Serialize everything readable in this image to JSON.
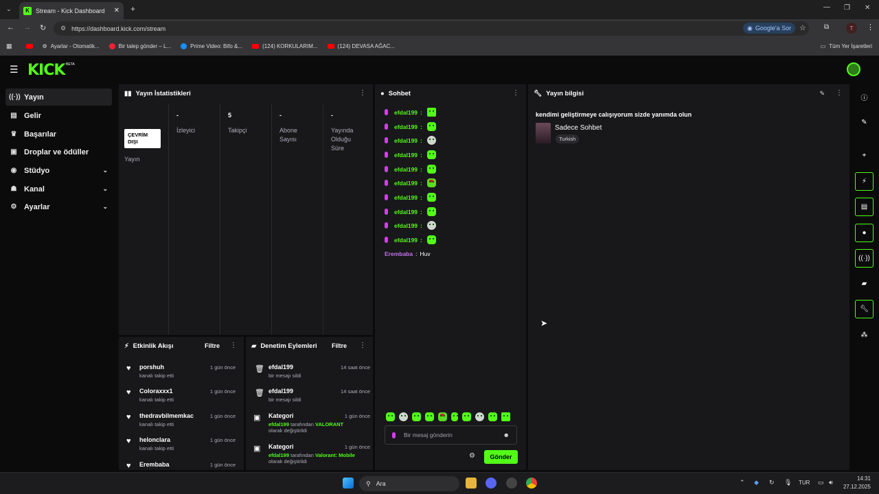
{
  "browser": {
    "tab_title": "Stream - Kick Dashboard",
    "url": "https://dashboard.kick.com/stream",
    "google_sor": "Google'a Sor",
    "profile_initial": "T",
    "bookmarks": [
      "Ayarlar - Otomatik...",
      "Bir talep gönder – L...",
      "Prime Video: Bifo &...",
      "(124) KORKULARIM...",
      "(124) DEVASA AĞAC..."
    ],
    "all_bookmarks": "Tüm Yer İşaretleri"
  },
  "kick": {
    "logo": "KICK",
    "beta": "BETA"
  },
  "sidebar": {
    "items": [
      {
        "label": "Yayın",
        "icon": "broadcast-icon"
      },
      {
        "label": "Gelir",
        "icon": "revenue-icon"
      },
      {
        "label": "Başarılar",
        "icon": "trophy-icon"
      },
      {
        "label": "Droplar ve ödüller",
        "icon": "gift-icon"
      },
      {
        "label": "Stüdyo",
        "icon": "studio-icon"
      },
      {
        "label": "Kanal",
        "icon": "channel-icon"
      },
      {
        "label": "Ayarlar",
        "icon": "settings-icon"
      }
    ]
  },
  "stats": {
    "title": "Yayın İstatistikleri",
    "status_badge": "ÇEVRİM DIŞI",
    "status_label": "Yayın",
    "viewers_value": "-",
    "viewers_label": "İzleyici",
    "followers_value": "5",
    "followers_label": "Takipçi",
    "subs_value": "-",
    "subs_label": "Abone Sayısı",
    "duration_value": "-",
    "duration_label": "Yayında Olduğu Süre"
  },
  "chat": {
    "title": "Sohbet",
    "messages": [
      {
        "user": "efdal199"
      },
      {
        "user": "efdal199"
      },
      {
        "user": "efdal199"
      },
      {
        "user": "efdal199"
      },
      {
        "user": "efdal199"
      },
      {
        "user": "efdal199"
      },
      {
        "user": "efdal199"
      },
      {
        "user": "efdal199"
      },
      {
        "user": "efdal199"
      },
      {
        "user": "efdal199"
      }
    ],
    "last_user": "Erembaba",
    "last_text": "Huv",
    "placeholder": "Bir mesaj gönderin",
    "send_label": "Gönder"
  },
  "info": {
    "title": "Yayın bilgisi",
    "stream_title": "kendimi geliştirmeye calışıyorum sizde yanımda olun",
    "category": "Sadece Sohbet",
    "language": "Turkish"
  },
  "activity": {
    "title": "Etkinlik Akışı",
    "filter": "Filtre",
    "items": [
      {
        "name": "porshuh",
        "sub": "kanalı takip etti",
        "time": "1 gün önce"
      },
      {
        "name": "Coloraxxx1",
        "sub": "kanalı takip etti",
        "time": "1 gün önce"
      },
      {
        "name": "thedravbilmemkac",
        "sub": "kanalı takip etti",
        "time": "1 gün önce"
      },
      {
        "name": "helonclara",
        "sub": "kanalı takip etti",
        "time": "1 gün önce"
      },
      {
        "name": "Erembaba",
        "sub": "",
        "time": "1 gün önce"
      }
    ]
  },
  "moderation": {
    "title": "Denetim Eylemleri",
    "filter": "Filtre",
    "items": [
      {
        "name": "efdal199",
        "time": "14 saat önce",
        "sub": "bir mesajı sildi"
      },
      {
        "name": "efdal199",
        "time": "14 saat önce",
        "sub": "bir mesajı sildi"
      },
      {
        "name": "Kategori",
        "time": "1 gün önce",
        "actor": "efdal199",
        "mid": "tarafından",
        "value": "VALORANT",
        "end": "olarak değiştirildi"
      },
      {
        "name": "Kategori",
        "time": "1 gün önce",
        "actor": "efdal199",
        "mid": "tarafından",
        "value": "Valorant: Mobile",
        "end": "olarak değiştirildi"
      }
    ]
  },
  "taskbar": {
    "search": "Ara",
    "lang": "TUR",
    "time": "14:31",
    "date": "27.12.2025"
  },
  "colors": {
    "accent": "#53fc18",
    "panel": "#18181b",
    "bg": "#0b0b0c"
  }
}
